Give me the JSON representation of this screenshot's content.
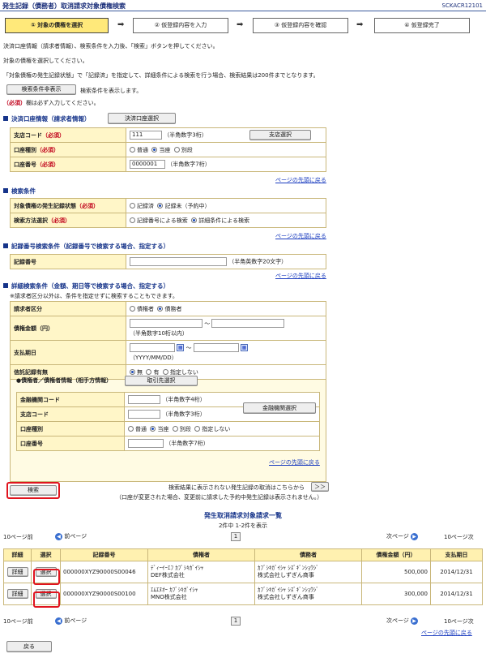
{
  "header": {
    "title": "発生記録（債務者）取消請求対象債権検索",
    "screen_code": "SCKACR12101"
  },
  "steps": [
    {
      "label": "① 対象の債権を選択"
    },
    {
      "label": "② 仮登録内容を入力"
    },
    {
      "label": "③ 仮登録内容を確認"
    },
    {
      "label": "④ 仮登録完了"
    }
  ],
  "arrow": "➡",
  "instructions": {
    "line1": "決済口座情報（請求者情報）、検索条件を入力後、「検索」ボタンを押してください。",
    "line2": "対象の債権を選択してください。",
    "line3": "「対象債権の発生記録状態」で「記録済」を指定して、詳細条件による検索を行う場合、検索結果は200件までとなります。",
    "toggle_button": "検索条件非表示",
    "toggle_note": "検索条件を表示します。",
    "required_mark": "（必須）",
    "required_note": "欄は必ず入力してください。"
  },
  "account_section": {
    "heading": "決済口座情報（請求者情報）",
    "select_button": "決済口座選択",
    "branch_label": "支店コード",
    "branch_value": "111",
    "branch_hint": "（半角数字3桁）",
    "branch_button": "支店選択",
    "type_label": "口座種別",
    "type_options": [
      "普通",
      "当座",
      "別段"
    ],
    "number_label": "口座番号",
    "number_value": "0000001",
    "number_hint": "（半角数字7桁）"
  },
  "page_top_link": "ページの先頭に戻る",
  "search_conditions": {
    "heading": "検索条件",
    "status_label": "対象債権の発生記録状態",
    "status_options": [
      "記録済",
      "記録未（予約中）"
    ],
    "method_label": "検索方法選択",
    "method_options": [
      "記録番号による検索",
      "詳細条件による検索"
    ]
  },
  "record_number_section": {
    "heading": "記録番号検索条件（記録番号で検索する場合、指定する）",
    "label": "記録番号",
    "hint": "（半角英数字20文字）"
  },
  "detail_section": {
    "heading": "詳細検索条件（金額、期日等で検索する場合、指定する）",
    "note": "※請求者区分以外は、条件を指定せずに検索することもできます。",
    "claimant_label": "請求者区分",
    "claimant_options": [
      "債権者",
      "債務者"
    ],
    "amount_label": "債権金額（円）",
    "amount_hint": "（半角数字10桁以内）",
    "range_sep": "～",
    "due_label": "支払期日",
    "date_hint": "（YYYY/MM/DD）",
    "transfer_label": "信託記録有無",
    "transfer_options": [
      "無",
      "有",
      "指定しない"
    ],
    "counterparty_heading": "●債権者／債権者情報（相手方情報）",
    "counterparty_button": "取引先選択",
    "bank_label": "金融機関コード",
    "bank_hint": "（半角数字4桁）",
    "bank_button": "金融機関選択",
    "cp_branch_label": "支店コード",
    "cp_branch_hint": "（半角数字3桁）",
    "cp_type_label": "口座種別",
    "cp_type_options": [
      "普通",
      "当座",
      "別段",
      "指定しない"
    ],
    "cp_number_label": "口座番号",
    "cp_number_hint": "（半角数字7桁）"
  },
  "search_button": "検索",
  "cancel_note": {
    "line1": "検索結果に表示されない発生記録の取消はこちらから",
    "line2": "（口座が変更された場合、変更前に請求した予約中発生記録は表示されません。）",
    "button": "＞＞"
  },
  "results": {
    "heading": "発生取消請求対象請求一覧",
    "count": "2件中 1-2件を表示",
    "prev10": "10ページ前",
    "prev": "前ページ",
    "next": "次ページ",
    "next10": "10ページ次",
    "current_page": "1",
    "columns": [
      "詳細",
      "選択",
      "記録番号",
      "債権者",
      "債務者",
      "債権金額（円）",
      "支払期日"
    ],
    "detail_button": "詳細",
    "select_button": "選択",
    "rows": [
      {
        "record": "000000XYZ90000S00046",
        "creditor_kana": "ﾃﾞｨｰｲｰｴﾌ ｶﾌﾞｼｷｶﾞｲｼｬ",
        "creditor": "DEF株式会社",
        "debtor_kana": "ｶﾌﾞｼｷｶﾞｲｼｬ ｼｽﾞｷﾞﾝｼｮｳｼﾞ",
        "debtor": "株式会社しずぎん商事",
        "amount": "500,000",
        "due": "2014/12/31"
      },
      {
        "record": "000000XYZ90000S00100",
        "creditor_kana": "ｴﾑｴﾇｵｰ ｶﾌﾞｼｷｶﾞｲｼｬ",
        "creditor": "MNO株式会社",
        "debtor_kana": "ｶﾌﾞｼｷｶﾞｲｼｬ ｼｽﾞｷﾞﾝｼｮｳｼﾞ",
        "debtor": "株式会社しずぎん商事",
        "amount": "300,000",
        "due": "2014/12/31"
      }
    ]
  },
  "back_button": "戻る"
}
